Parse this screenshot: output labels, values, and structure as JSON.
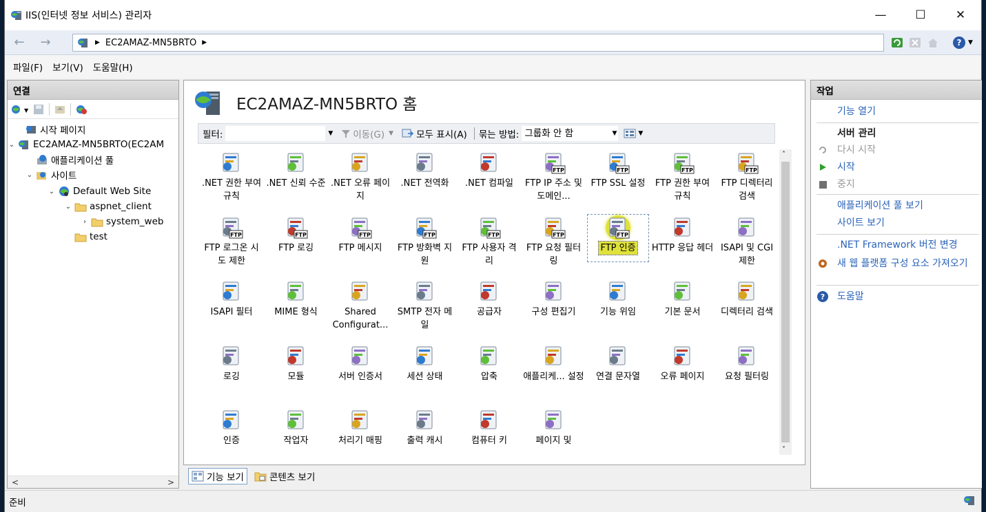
{
  "window": {
    "title": "IIS(인터넷 정보 서비스) 관리자",
    "minimize": "—",
    "maximize": "☐",
    "close": "✕"
  },
  "address": {
    "server": "EC2AMAZ-MN5BRTO"
  },
  "menu": [
    "파일(F)",
    "보기(V)",
    "도움말(H)"
  ],
  "connections": {
    "header": "연결",
    "tree": [
      {
        "label": "시작 페이지"
      },
      {
        "label": "EC2AMAZ-MN5BRTO(EC2AM"
      },
      {
        "label": "애플리케이션 풀"
      },
      {
        "label": "사이트"
      },
      {
        "label": "Default Web Site"
      },
      {
        "label": "aspnet_client"
      },
      {
        "label": "system_web"
      },
      {
        "label": "test"
      }
    ]
  },
  "center": {
    "title": "EC2AMAZ-MN5BRTO 홈",
    "filter": {
      "label": "필터:",
      "input_value": "",
      "go_label": "이동(G)",
      "show_all_label": "모두 표시(A)",
      "group_by_label": "묶는 방법:",
      "group_by_value": "그룹화 안 함"
    },
    "features": [
      ".NET 권한 부여 규칙",
      ".NET 신뢰 수준",
      ".NET 오류 페이지",
      ".NET 전역화",
      ".NET 컴파일",
      "FTP IP 주소 및 도메인...",
      "FTP SSL 설정",
      "FTP 권한 부여 규칙",
      "FTP 디렉터리 검색",
      "FTP 로그온 시도 제한",
      "FTP 로깅",
      "FTP 메시지",
      "FTP 방화벽 지원",
      "FTP 사용자 격리",
      "FTP 요청 필터링",
      "FTP 인증",
      "HTTP 응답 헤더",
      "ISAPI 및 CGI 제한",
      "ISAPI 필터",
      "MIME 형식",
      "Shared Configurat...",
      "SMTP 전자 메일",
      "공급자",
      "구성 편집기",
      "기능 위임",
      "기본 문서",
      "디렉터리 검색",
      "로깅",
      "모듈",
      "서버 인증서",
      "세션 상태",
      "압축",
      "애플리케... 설정",
      "연결 문자열",
      "오류 페이지",
      "요청 필터링",
      "인증",
      "작업자",
      "처리기 매핑",
      "출력 캐시",
      "컴퓨터 키",
      "페이지 및"
    ],
    "selected_feature": "FTP 인증",
    "views": {
      "features_view": "기능 보기",
      "content_view": "콘텐츠 보기"
    }
  },
  "actions": {
    "header": "작업",
    "open_feature": "기능 열기",
    "manage_server": "서버 관리",
    "restart": "다시 시작",
    "start": "시작",
    "stop": "중지",
    "view_app_pools": "애플리케이션 풀 보기",
    "view_sites": "사이트 보기",
    "change_net_version": ".NET Framework 버전 변경",
    "get_web_platform": "새 웹 플랫폼 구성 요소 가져오기",
    "help": "도움말"
  },
  "status": {
    "text": "준비"
  },
  "colors": {
    "link": "#2a63b8",
    "selection": "#dfe23a",
    "nav_bg": "#e9eef6"
  }
}
